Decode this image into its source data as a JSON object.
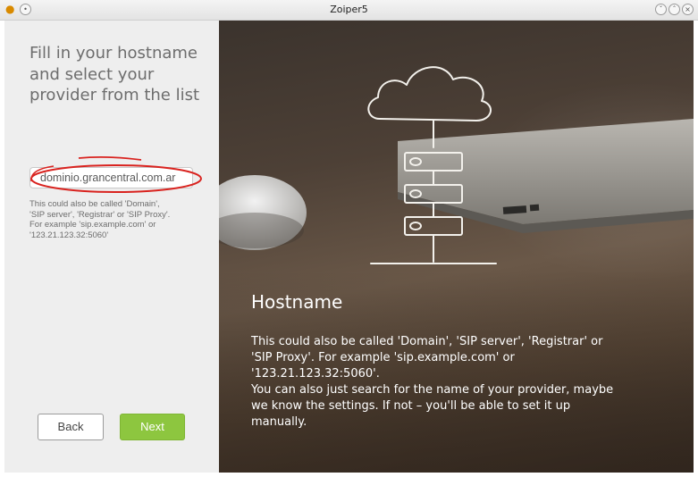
{
  "window": {
    "title": "Zoiper5",
    "app_icon": "zoiper-icon",
    "controls": [
      "minimize-icon",
      "maximize-icon",
      "close-icon"
    ]
  },
  "left_panel": {
    "heading_lines": [
      "Fill in your hostname",
      "and select your",
      "provider from the list"
    ],
    "hostname_input": {
      "value": "dominio.grancentral.com.ar",
      "placeholder": ""
    },
    "helper_lines": [
      "This could also be called 'Domain',",
      "'SIP server', 'Registrar' or 'SIP Proxy'.",
      "For example 'sip.example.com' or",
      "'123.21.123.32:5060'"
    ],
    "back_label": "Back",
    "next_label": "Next"
  },
  "info_panel": {
    "title": "Hostname",
    "text_lines": [
      "This could also be called 'Domain', 'SIP server', 'Registrar' or",
      "'SIP Proxy'. For example 'sip.example.com' or",
      "'123.21.123.32:5060'.",
      "You can also just search for the name of your provider, maybe",
      "we know the settings. If not – you'll be able to set it up",
      "manually."
    ],
    "illustration": "cloud-server-icon"
  },
  "colors": {
    "accent_green": "#8dc63f",
    "annotation_red": "#d9231f",
    "heading_gray": "#6d6d6d"
  }
}
